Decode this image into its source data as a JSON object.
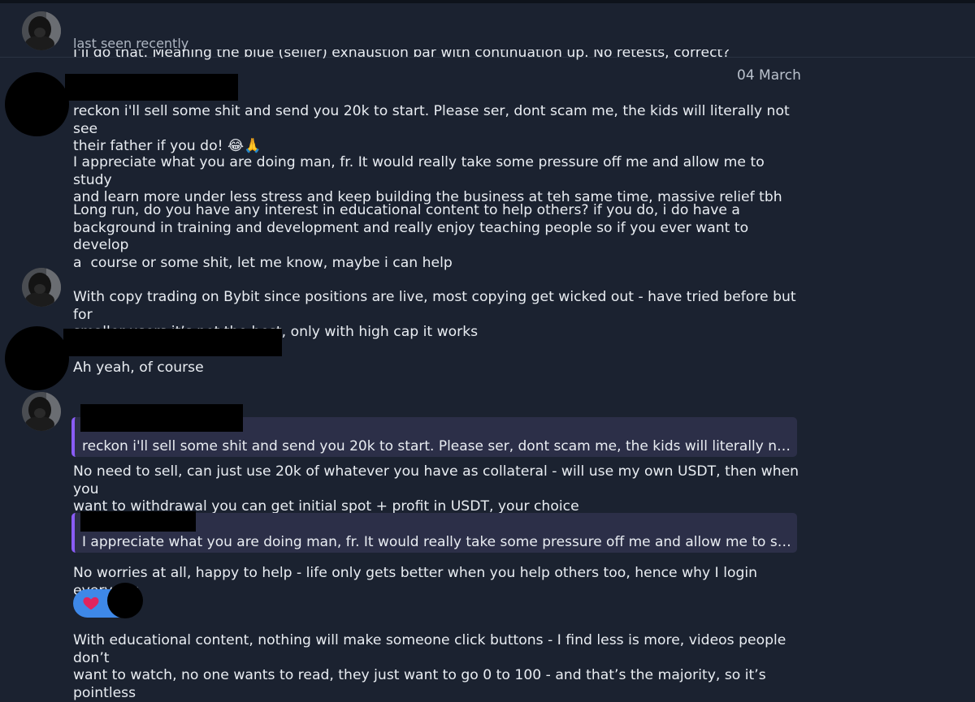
{
  "header": {
    "name": "",
    "status": "last seen recently"
  },
  "partial_message": "I'll do that. Meaning the blue (seller) exhaustion bar with continuation up. No retests, correct?",
  "date_separator": "04 March",
  "messages": [
    {
      "text": "reckon i'll sell some shit and send you 20k to start. Please ser, dont scam me, the kids will literally not see\ntheir father if you do! 😂🙏"
    },
    {
      "text": "I appreciate what you are doing man, fr. It would really take some pressure off me and allow me to study\nand learn more under less stress and keep building the business at teh same time, massive relief tbh"
    },
    {
      "text": "Long run, do you have any interest in educational content to help others? if you do, i do have a\nbackground in training and development and really enjoy teaching people so if you ever want to develop\na  course or some shit, let me know, maybe i can help"
    },
    {
      "text": "With copy trading on Bybit since positions are live, most copying get wicked out - have tried before but for\nsmaller users it’s not the best, only with high cap it works"
    },
    {
      "text": "Ah yeah, of course"
    },
    {
      "quote": "reckon i'll sell some shit and send you 20k to start. Please ser, dont scam me, the kids will literally not se...",
      "text": "No need to sell, can just use 20k of whatever you have as collateral - will use my own USDT, then when you\nwant to withdrawal you can get initial spot + profit in USDT, your choice"
    },
    {
      "quote": "I appreciate what you are doing man, fr. It would really take some pressure off me and allow me to study...",
      "text": "No worries at all, happy to help - life only gets better when you help others too, hence why I login everyday"
    },
    {
      "text": "With educational content, nothing will make someone click buttons - I find less is more, videos people don’t\nwant to watch, no one wants to read, they just want to go 0 to 100 - and that’s the majority, so it’s pointless"
    }
  ],
  "reaction": {
    "icon": "heart-icon",
    "color": "#e0245e"
  },
  "colors": {
    "background": "#1b2230",
    "quote_bar": "#8a5cf6",
    "quote_bg": "#2c2f48",
    "reaction_bg": "#3e88e8"
  }
}
